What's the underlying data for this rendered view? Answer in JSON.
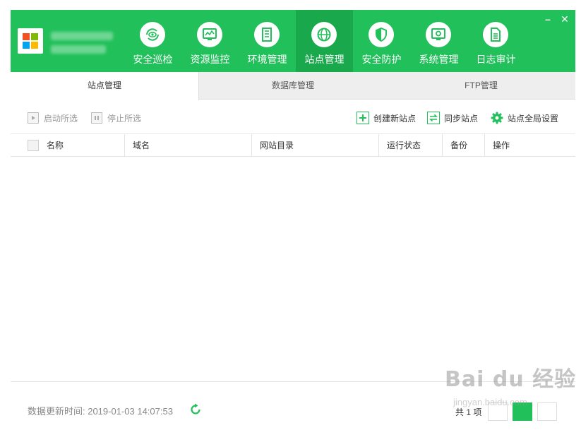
{
  "window": {
    "minimize_label": "–",
    "close_label": "✕"
  },
  "nav": {
    "items": [
      {
        "label": "安全巡检",
        "icon": "eye-cycle-icon"
      },
      {
        "label": "资源监控",
        "icon": "monitor-chart-icon"
      },
      {
        "label": "环境管理",
        "icon": "server-icon"
      },
      {
        "label": "站点管理",
        "icon": "globe-icon",
        "active": true
      },
      {
        "label": "安全防护",
        "icon": "shield-icon"
      },
      {
        "label": "系统管理",
        "icon": "settings-monitor-icon"
      },
      {
        "label": "日志审计",
        "icon": "document-icon"
      }
    ]
  },
  "tabs": [
    {
      "label": "站点管理",
      "active": true
    },
    {
      "label": "数据库管理"
    },
    {
      "label": "FTP管理"
    }
  ],
  "toolbar": {
    "start_label": "启动所选",
    "stop_label": "停止所选",
    "create_label": "创建新站点",
    "sync_label": "同步站点",
    "settings_label": "站点全局设置"
  },
  "table": {
    "columns": [
      "名称",
      "域名",
      "网站目录",
      "运行状态",
      "备份",
      "操作"
    ],
    "rows": []
  },
  "footer": {
    "update_label": "数据更新时间: 2019-01-03 14:07:53",
    "count_label": "共 1 项"
  },
  "watermark": {
    "text": "Bai du 经验",
    "url": "jingyan.baidu.com"
  },
  "colors": {
    "accent": "#21c05a",
    "accent_active": "#19a94c"
  }
}
